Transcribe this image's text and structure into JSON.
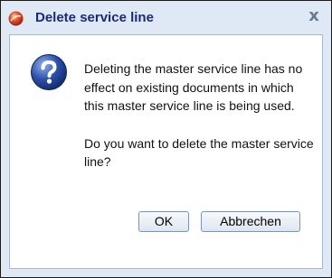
{
  "window": {
    "title": "Delete service line",
    "app_icon": "app-logo-icon",
    "close_glyph": "x"
  },
  "message": {
    "icon": "question-icon",
    "paragraph1": "Deleting the master service line has no effect on existing documents in which this master service line is being used.",
    "paragraph2": "Do you want to delete the master service line?"
  },
  "buttons": {
    "ok_label": "OK",
    "cancel_label": "Abbrechen"
  },
  "colors": {
    "title_text": "#1a2a7a",
    "chrome_background": "#dfe9f5",
    "content_background": "#ffffff",
    "question_icon": "#2a4fa8"
  }
}
